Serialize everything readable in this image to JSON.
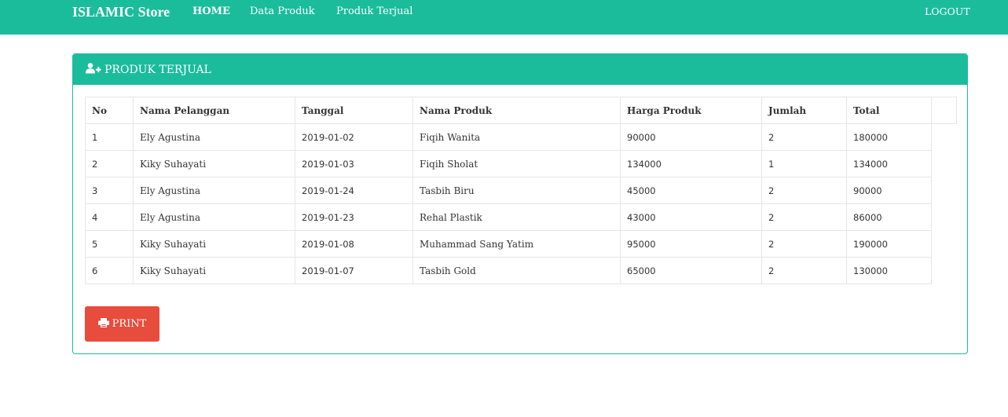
{
  "navbar": {
    "brand": "ISLAMIC Store",
    "links": [
      "HOME",
      "Data Produk",
      "Produk Terjual"
    ],
    "logout": "LOGOUT"
  },
  "panel": {
    "title": "PRODUK TERJUAL",
    "icon": "user-plus-icon"
  },
  "table": {
    "headers": [
      "No",
      "Nama Pelanggan",
      "Tanggal",
      "Nama Produk",
      "Harga Produk",
      "Jumlah",
      "Total"
    ],
    "rows": [
      [
        "1",
        "Ely Agustina",
        "2019-01-02",
        "Fiqih Wanita",
        "90000",
        "2",
        "180000"
      ],
      [
        "2",
        "Kiky Suhayati",
        "2019-01-03",
        "Fiqih Sholat",
        "134000",
        "1",
        "134000"
      ],
      [
        "3",
        "Ely Agustina",
        "2019-01-24",
        "Tasbih Biru",
        "45000",
        "2",
        "90000"
      ],
      [
        "4",
        "Ely Agustina",
        "2019-01-23",
        "Rehal Plastik",
        "43000",
        "2",
        "86000"
      ],
      [
        "5",
        "Kiky Suhayati",
        "2019-01-08",
        "Muhammad Sang Yatim",
        "95000",
        "2",
        "190000"
      ],
      [
        "6",
        "Kiky Suhayati",
        "2019-01-07",
        "Tasbih Gold",
        "65000",
        "2",
        "130000"
      ]
    ]
  },
  "print_button": {
    "label": "PRINT",
    "icon": "printer-icon"
  },
  "colors": {
    "primary": "#1abc9c",
    "danger": "#e74c3c"
  }
}
